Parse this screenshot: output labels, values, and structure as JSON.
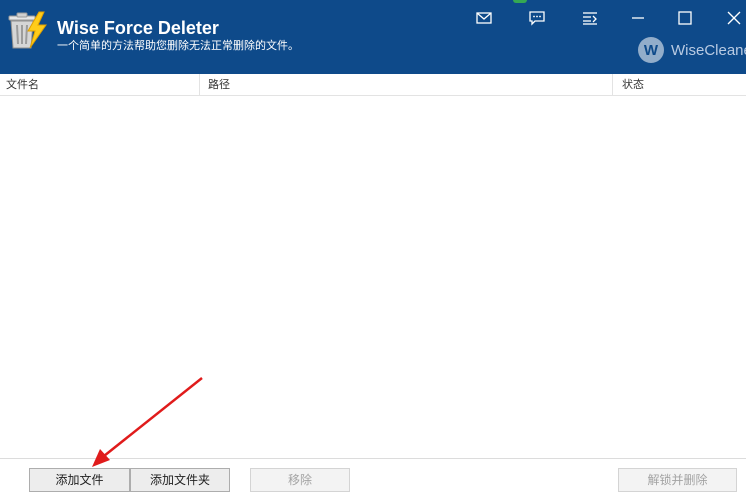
{
  "window": {
    "title": "Wise Force Deleter",
    "subtitle": "一个简单的方法帮助您删除无法正常删除的文件。",
    "brand": "WiseCleane",
    "brand_initial": "W",
    "accent_color": "#0e4a8a"
  },
  "titlebar_buttons": [
    {
      "name": "mail-icon"
    },
    {
      "name": "feedback-icon"
    },
    {
      "name": "menu-icon"
    },
    {
      "name": "minimize-icon"
    },
    {
      "name": "maximize-icon"
    },
    {
      "name": "close-icon"
    }
  ],
  "table": {
    "columns": [
      "文件名",
      "路径",
      "状态"
    ],
    "rows": []
  },
  "buttons": {
    "add_file": "添加文件",
    "add_folder": "添加文件夹",
    "remove": "移除",
    "unlock_delete": "解锁并删除"
  }
}
